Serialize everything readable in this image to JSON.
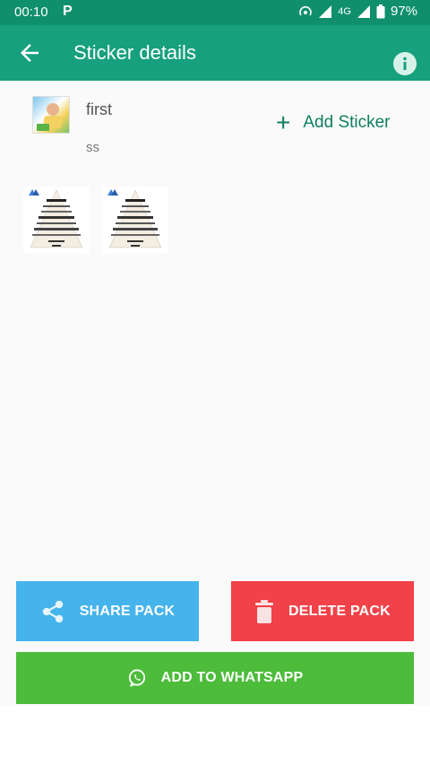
{
  "status_bar": {
    "time": "00:10",
    "p_icon": "P",
    "network": "4G",
    "battery": "97%"
  },
  "app_bar": {
    "title": "Sticker details",
    "back_icon": "arrow-back-icon",
    "info_icon": "info-icon"
  },
  "pack": {
    "name": "first",
    "publisher": "ss"
  },
  "actions": {
    "add_sticker": "Add Sticker",
    "share": "SHARE PACK",
    "delete": "DELETE PACK",
    "whatsapp": "ADD TO WHATSAPP"
  },
  "colors": {
    "status_bar": "#0f8f6b",
    "app_bar": "#16a07d",
    "accent": "#0f7f5f",
    "share": "#45b3ec",
    "delete": "#f04248",
    "whatsapp": "#4cbc3a"
  }
}
